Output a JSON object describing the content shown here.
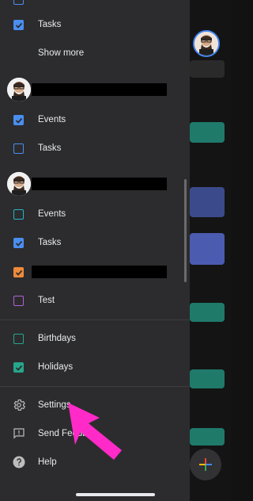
{
  "colors": {
    "blue": "#4a8ef0",
    "red": "#ee8a3a",
    "purple": "#b061d6",
    "teal": "#26b5a3",
    "pink": "#ff2ac7"
  },
  "top": {
    "tasks_label": "Tasks",
    "show_more_label": "Show more"
  },
  "account1": {
    "items": [
      {
        "label": "Events",
        "checked": true
      },
      {
        "label": "Tasks",
        "checked": false
      }
    ]
  },
  "account2": {
    "items": [
      {
        "label": "Events",
        "checked": false
      },
      {
        "label": "Tasks",
        "checked": true
      },
      {
        "label": "",
        "checked": true
      },
      {
        "label": "Test",
        "checked": false
      }
    ]
  },
  "other": {
    "items": [
      {
        "label": "Birthdays",
        "checked": false
      },
      {
        "label": "Holidays",
        "checked": true
      }
    ]
  },
  "menu": {
    "settings_label": "Settings",
    "feedback_label": "Send Feedb",
    "help_label": "Help"
  }
}
